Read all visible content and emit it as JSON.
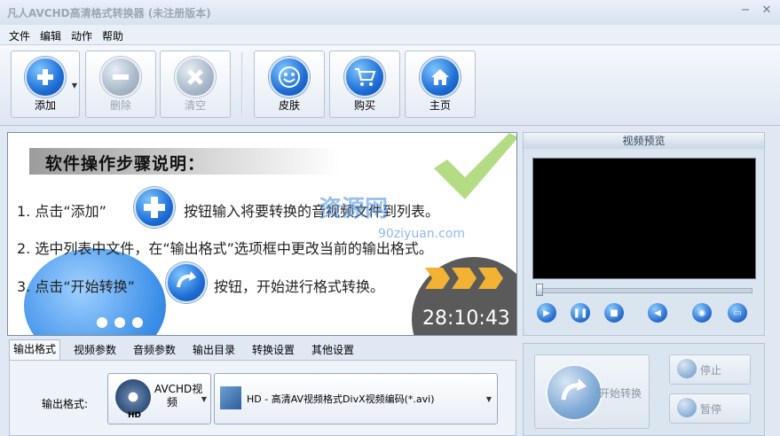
{
  "window": {
    "title": "凡人AVCHD高清格式转换器  (未注册版本)"
  },
  "menu": [
    "文件",
    "编辑",
    "动作",
    "帮助"
  ],
  "toolbar": {
    "add": "添加",
    "delete": "删除",
    "clear": "清空",
    "skin": "皮肤",
    "buy": "购买",
    "home": "主页"
  },
  "guide": {
    "title": "软件操作步骤说明：",
    "step1_a": "1. 点击“添加”",
    "step1_b": "按钮输入将要转换的音视频文件到列表。",
    "step2": "2. 选中列表中文件，在“输出格式”选项框中更改当前的输出格式。",
    "step3_a": "3. 点击“开始转换”",
    "step3_b": "按钮，开始进行格式转换。",
    "watermark": "资源网",
    "watermark_url": "90ziyuan.com",
    "clock": "28:10:43"
  },
  "preview": {
    "title": "视频预览"
  },
  "tabs": [
    "输出格式",
    "视频参数",
    "音频参数",
    "输出目录",
    "转换设置",
    "其他设置"
  ],
  "output": {
    "label": "输出格式:",
    "format_name_line1": "AVCHD视",
    "format_name_line2": "频",
    "format_badge": "HD",
    "codec": "HD - 高清AV视频格式DivX视频编码(*.avi)"
  },
  "actions": {
    "start": "开始转换",
    "stop": "停止",
    "pause": "暂停"
  },
  "colors": {
    "accent": "#1f6fd6",
    "background": "#dfe8f3"
  }
}
